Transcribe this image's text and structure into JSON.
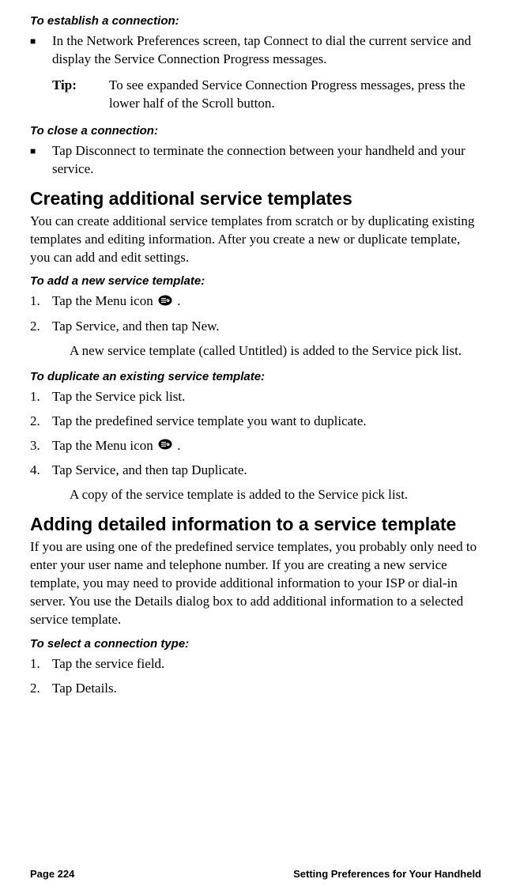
{
  "sections": {
    "establish": {
      "heading": "To establish a connection:",
      "bullet": "In the Network Preferences screen, tap Connect to dial the current service and display the Service Connection Progress messages.",
      "tip_label": "Tip:",
      "tip_text": "To see expanded Service Connection Progress messages, press the lower half of the Scroll button."
    },
    "close": {
      "heading": "To close a connection:",
      "bullet": "Tap Disconnect to terminate the connection between your handheld and your service."
    },
    "creating": {
      "heading": "Creating additional service templates",
      "body": "You can create additional service templates from scratch or by duplicating existing templates and editing information. After you create a new or duplicate template, you can add and edit settings."
    },
    "add_template": {
      "heading": "To add a new service template:",
      "step1_pre": "Tap the Menu icon ",
      "step1_post": " .",
      "step2": "Tap Service, and then tap New.",
      "result": "A new service template (called Untitled) is added to the Service pick list."
    },
    "duplicate": {
      "heading": "To duplicate an existing service template:",
      "step1": "Tap the Service pick list.",
      "step2": "Tap the predefined service template you want to duplicate.",
      "step3_pre": "Tap the Menu icon ",
      "step3_post": " .",
      "step4": "Tap Service, and then tap Duplicate.",
      "result": "A copy of the service template is added to the Service pick list."
    },
    "adding_detail": {
      "heading": "Adding detailed information to a service template",
      "body": "If you are using one of the predefined service templates, you probably only need to enter your user name and telephone number. If you are creating a new service template, you may need to provide additional information to your ISP or dial-in server. You use the Details dialog box to add additional information to a selected service template."
    },
    "select_conn": {
      "heading": "To select a connection type:",
      "step1": "Tap the service field.",
      "step2": "Tap Details."
    }
  },
  "numbers": {
    "n1": "1.",
    "n2": "2.",
    "n3": "3.",
    "n4": "4."
  },
  "bullet_char": "■",
  "footer": {
    "page": "Page 224",
    "chapter": "Setting Preferences for Your Handheld"
  }
}
